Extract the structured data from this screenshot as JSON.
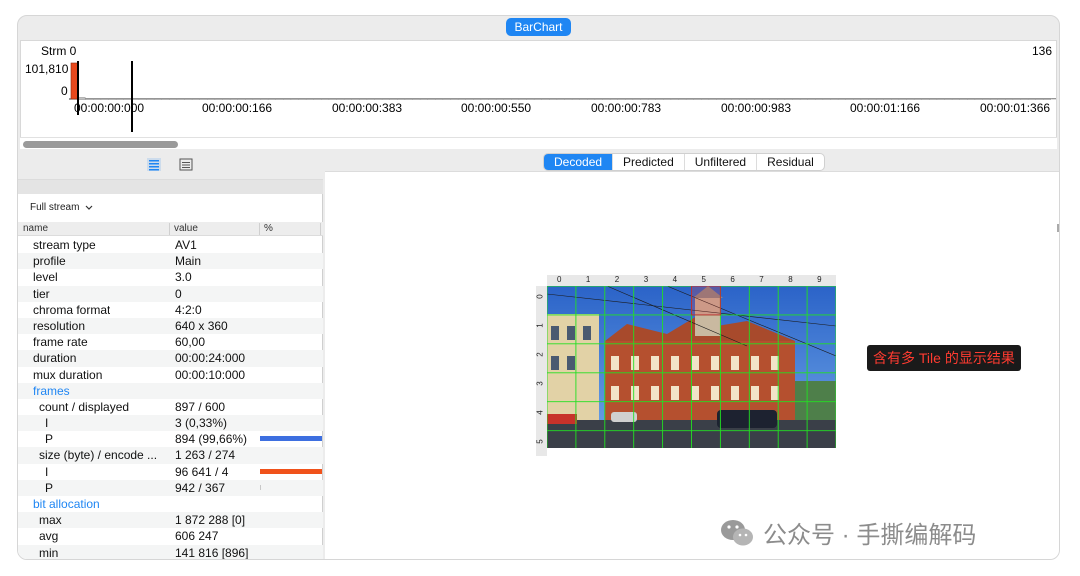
{
  "top_tab": "BarChart",
  "chart": {
    "stream_label": "Strm 0",
    "max_label": "101,810",
    "zero_label": "0",
    "right_count": "136",
    "time_labels": [
      "00:00:00:000",
      "00:00:00:166",
      "00:00:00:383",
      "00:00:00:550",
      "00:00:00:783",
      "00:00:00:983",
      "00:00:01:166",
      "00:00:01:366"
    ]
  },
  "chart_data": {
    "type": "bar",
    "ylim": [
      0,
      101810
    ],
    "values": [
      101810,
      4000,
      0,
      0,
      0,
      0,
      0,
      0,
      0,
      0,
      0,
      0,
      0,
      0,
      0,
      0,
      0,
      0,
      0,
      0,
      0,
      0,
      0,
      0,
      0,
      0,
      0,
      0,
      0,
      0,
      0,
      0,
      0,
      0,
      0,
      0,
      0,
      0,
      0,
      0,
      0,
      0,
      0,
      0,
      0,
      0,
      0,
      0,
      0,
      0,
      0,
      0,
      0,
      0,
      0,
      0,
      0,
      0,
      0,
      0,
      0,
      0,
      0,
      0,
      0,
      0,
      0,
      0,
      0,
      0,
      0,
      0,
      0,
      0,
      0,
      0,
      0,
      0,
      0,
      0,
      0,
      0,
      0,
      0,
      0,
      0,
      0,
      0,
      0,
      0,
      0,
      0,
      0,
      0,
      0,
      0,
      0,
      0,
      0,
      0,
      0,
      0,
      0,
      0,
      0,
      0,
      0,
      0,
      0,
      0,
      0,
      0,
      0,
      0,
      0,
      0,
      0,
      0,
      0,
      0,
      0,
      0,
      0,
      0,
      0,
      0,
      0,
      0,
      0,
      0,
      0,
      0,
      0,
      0,
      0,
      0
    ],
    "highlights": [
      {
        "index": 0,
        "color": "#e8491d"
      }
    ]
  },
  "toolbar": {
    "icons": [
      "list-view-icon",
      "detail-view-icon"
    ]
  },
  "stream_select": {
    "value": "Full stream"
  },
  "table": {
    "headers": {
      "name": "name",
      "value": "value",
      "pct": "%"
    },
    "rows": [
      {
        "name": "stream type",
        "value": "AV1",
        "indent": 1
      },
      {
        "name": "profile",
        "value": "Main",
        "indent": 1
      },
      {
        "name": "level",
        "value": "3.0",
        "indent": 1
      },
      {
        "name": "tier",
        "value": "0",
        "indent": 1
      },
      {
        "name": "chroma format",
        "value": "4:2:0",
        "indent": 1
      },
      {
        "name": "resolution",
        "value": "640 x 360",
        "indent": 1
      },
      {
        "name": "frame rate",
        "value": "60,00",
        "indent": 1
      },
      {
        "name": "duration",
        "value": "00:00:24:000",
        "indent": 1
      },
      {
        "name": "mux duration",
        "value": "00:00:10:000",
        "indent": 1
      },
      {
        "name": "frames",
        "value": "",
        "indent": 1,
        "section": true
      },
      {
        "name": "count / displayed",
        "value": "897 / 600",
        "indent": 2
      },
      {
        "name": "I",
        "value": "3 (0,33%)",
        "indent": 3
      },
      {
        "name": "P",
        "value": "894 (99,66%)",
        "indent": 3,
        "bar_pct": 99.66,
        "bar_color": "#3d6fe0"
      },
      {
        "name": "size (byte) / encode ...",
        "value": "1 263 / 274",
        "indent": 2
      },
      {
        "name": "I",
        "value": "96 641 / 4",
        "indent": 3,
        "bar_pct": 100,
        "bar_color": "#f0521b"
      },
      {
        "name": "P",
        "value": "942 / 367",
        "indent": 3,
        "bar_pct": 1,
        "bar_color": "#c8c8c8"
      },
      {
        "name": "bit allocation",
        "value": "",
        "indent": 1,
        "section": true
      },
      {
        "name": "max",
        "value": "1 872 288 [0]",
        "indent": 2
      },
      {
        "name": "avg",
        "value": "606 247",
        "indent": 2
      },
      {
        "name": "min",
        "value": "141 816 [896]",
        "indent": 2
      }
    ]
  },
  "view_tabs": [
    "Decoded",
    "Predicted",
    "Unfiltered",
    "Residual"
  ],
  "active_view_tab": "Decoded",
  "frame": {
    "col_labels": [
      "0",
      "1",
      "2",
      "3",
      "4",
      "5",
      "6",
      "7",
      "8",
      "9"
    ],
    "row_labels": [
      "0",
      "1",
      "2",
      "3",
      "4",
      "5"
    ],
    "grid_color": "#22e022"
  },
  "annotation": "含有多 Tile 的显示结果",
  "watermark": "公众号 · 手撕编解码"
}
